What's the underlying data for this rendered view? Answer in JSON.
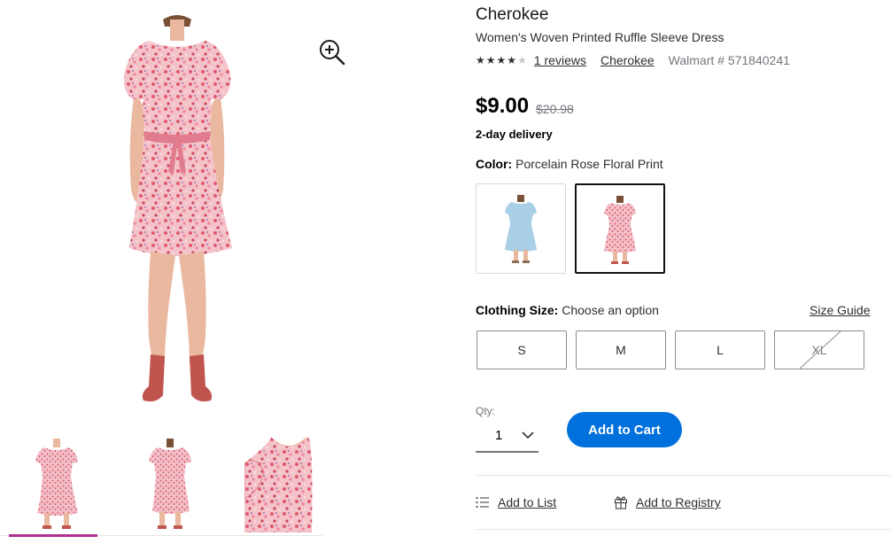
{
  "product": {
    "brand_title": "Cherokee",
    "name": "Women's Woven Printed Ruffle Sleeve Dress",
    "rating_stars": 4,
    "rating_max": 5,
    "reviews_link": "1 reviews",
    "brand_link": "Cherokee",
    "item_number": "Walmart # 571840241"
  },
  "pricing": {
    "price": "$9.00",
    "was_price": "$20.98",
    "delivery": "2-day delivery"
  },
  "color": {
    "label": "Color:",
    "selected_value": "Porcelain Rose Floral Print",
    "swatches": [
      {
        "name": "light-blue-dress",
        "fill": "#a9cfe6",
        "selected": false
      },
      {
        "name": "pink-floral-dress",
        "fill": "#e89aa6",
        "selected": true
      }
    ]
  },
  "size": {
    "label": "Clothing Size:",
    "prompt": "Choose an option",
    "guide_link": "Size Guide",
    "options": [
      {
        "label": "S",
        "available": true
      },
      {
        "label": "M",
        "available": true
      },
      {
        "label": "L",
        "available": true
      },
      {
        "label": "XL",
        "available": false
      }
    ]
  },
  "quantity": {
    "label": "Qty:",
    "value": "1"
  },
  "actions": {
    "add_to_cart": "Add to Cart",
    "add_to_list": "Add to List",
    "add_to_registry": "Add to Registry"
  },
  "icons": {
    "zoom": "zoom-in-icon",
    "chevron": "chevron-down-icon",
    "list": "list-icon",
    "registry": "gift-icon"
  },
  "colors": {
    "accent_blue": "#0071dc",
    "thumb_indicator": "#b0308f",
    "dress_pink": "#f0a7b3",
    "dress_pattern": "#d8475e"
  }
}
